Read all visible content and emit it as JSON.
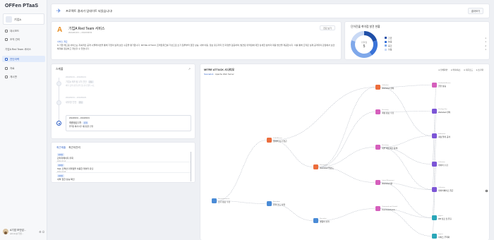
{
  "sidebar": {
    "logo": "OFFen PTaaS",
    "org_name": "기업A",
    "items": [
      {
        "label": "대시보드",
        "icon": "dashboard-icon",
        "active": false
      },
      {
        "label": "조직 관리",
        "icon": "org-icon",
        "active": false
      },
      {
        "label": "기업A Red Team 서비스",
        "icon": "",
        "active": false
      },
      {
        "label": "진단이력",
        "icon": "history-icon",
        "active": true
      },
      {
        "label": "자료",
        "icon": "file-icon",
        "active": false
      },
      {
        "label": "게시판",
        "icon": "board-icon",
        "active": false
      }
    ],
    "user": {
      "name": "A기업 보안담...",
      "email": "admin@기업..."
    }
  },
  "topbar": {
    "message": "프로젝트 결과가 업데이트 되었습니다!",
    "button": "결과보기"
  },
  "service": {
    "title": "기업A Red Team 서비스",
    "date": "2024/01/01 ~ 2024/03/31",
    "button": "진단 보기",
    "section_label": "서비스 개요",
    "description": "N 기업 레드팀 서비스는 지속적인 공격 시뮬레이션을 통해 기업의 실제 보안 수준을 평가합니다. MITRE ATT&CK 프레임워크를 기반으로 초기 침투부터 권한 상승, 내부 이동, 정보 유출까지 전 과정을 검증하며, 발견된 취약점에 대한 상세한 분석과 대응 방안을 제공합니다. 이를 통해 조직은 실제 공격자의 관점에서 보안 체계를 점검하고 개선할 수 있습니다."
  },
  "vuln_status": {
    "title": "단어진율 취약점 발견 현황",
    "center_label": "취약점",
    "center_value": "5",
    "legend": [
      {
        "label": "긴급",
        "value": "1",
        "color": "#1f4fa8"
      },
      {
        "label": "높음",
        "value": "1",
        "color": "#3a73d8"
      },
      {
        "label": "중간",
        "value": "2",
        "color": "#7fa8ea"
      },
      {
        "label": "낮음",
        "value": "1",
        "color": "#c9d9f5"
      }
    ]
  },
  "schedule": {
    "title": "스케줄",
    "more": "↗",
    "items": [
      {
        "date": "2024/01/01 ~ 2024/01/31",
        "title": "기업A 레드팀 1차 진단",
        "chip": "완료",
        "note": "외부 공격 표면 분석 및 초기 침투 시도"
      },
      {
        "date": "2024/02/01 ~ 2024/02/29",
        "title": "내부망 진단",
        "chip": "완료",
        "note": ""
      },
      {
        "date": "2024/03/01 ~ 2024/03/31",
        "title": "최종점검 2차",
        "chip": "진행",
        "note": "취약점 패치 이후 재점검을 진행"
      }
    ]
  },
  "recent": {
    "tab_active": "최근제출",
    "tab_other": "최근이관리",
    "items": [
      {
        "badge": "취약점",
        "text": "관리자페이지 우회",
        "date": "2024-03-12"
      },
      {
        "badge": "취약점",
        "text": "SQL 인젝션 취약점을 이용한 데이터 유출",
        "date": "2024-03-08"
      },
      {
        "badge": "취약점",
        "text": "내부 권한 상승 확인",
        "date": "2024-03-02"
      }
    ]
  },
  "attack": {
    "title": "MITRE ATT&CK 시나리오",
    "scenario_label": "Scenario1",
    "scenario_name": "Apache Web Server",
    "options": [
      "● 전체화면",
      "● 확대/축소",
      "● 다운로드",
      "● 초기화"
    ],
    "nodes": [
      {
        "id": "n1",
        "tactic": "Reconnaissance",
        "label": "초기 정보 수집",
        "color": "blue"
      },
      {
        "id": "n2",
        "tactic": "Initial Access",
        "label": "웹서버 초기 접근",
        "color": "orange"
      },
      {
        "id": "n3",
        "tactic": "Execution",
        "label": "원격 코드 실행",
        "color": "blue"
      },
      {
        "id": "n4",
        "tactic": "Persistence",
        "label": "Webshell 업로드",
        "color": "orange"
      },
      {
        "id": "n5",
        "tactic": "Execution",
        "label": "명령어 실행",
        "color": "blue"
      },
      {
        "id": "n6",
        "tactic": "Collection",
        "label": "Webshell 설치",
        "color": "orange"
      },
      {
        "id": "n7",
        "tactic": "Discovery",
        "label": "계정 정보 수집",
        "color": "pink"
      },
      {
        "id": "n8",
        "tactic": "Discovery",
        "label": "내부 네트워크 탐색",
        "color": "pink"
      },
      {
        "id": "n9",
        "tactic": "Lateral Movement",
        "label": "Webshell 활",
        "color": "pink"
      },
      {
        "id": "n10",
        "tactic": "Command and Control",
        "label": "Command and...",
        "color": "pink"
      },
      {
        "id": "n11",
        "tactic": "Credential Access",
        "label": "권한 상승",
        "color": "pink"
      },
      {
        "id": "n12",
        "tactic": "Privilege Esc.",
        "label": "Webshell 설치",
        "color": "purple"
      },
      {
        "id": "n13",
        "tactic": "Exfiltration",
        "label": "계정 탈취 공격",
        "color": "purple"
      },
      {
        "id": "n14",
        "tactic": "Collection",
        "label": "데이터 수집",
        "color": "purple"
      },
      {
        "id": "n15",
        "tactic": "Collection",
        "label": "데이터베이스 접근",
        "color": "purple"
      },
      {
        "id": "n16",
        "tactic": "Impact",
        "label": "DB 덤프 및 유출",
        "color": "teal"
      },
      {
        "id": "n17",
        "tactic": "Impact",
        "label": "서비스 무력화",
        "color": "teal"
      },
      {
        "id": "n18",
        "tactic": "Exfiltration",
        "label": "데이터 유출 시도",
        "color": "teal"
      },
      {
        "id": "n19",
        "tactic": "Exfiltration",
        "label": "Privilege Escala...",
        "color": "teal"
      },
      {
        "id": "n20",
        "tactic": "Impact",
        "label": "최종 목표 달성",
        "color": "teal"
      }
    ]
  }
}
